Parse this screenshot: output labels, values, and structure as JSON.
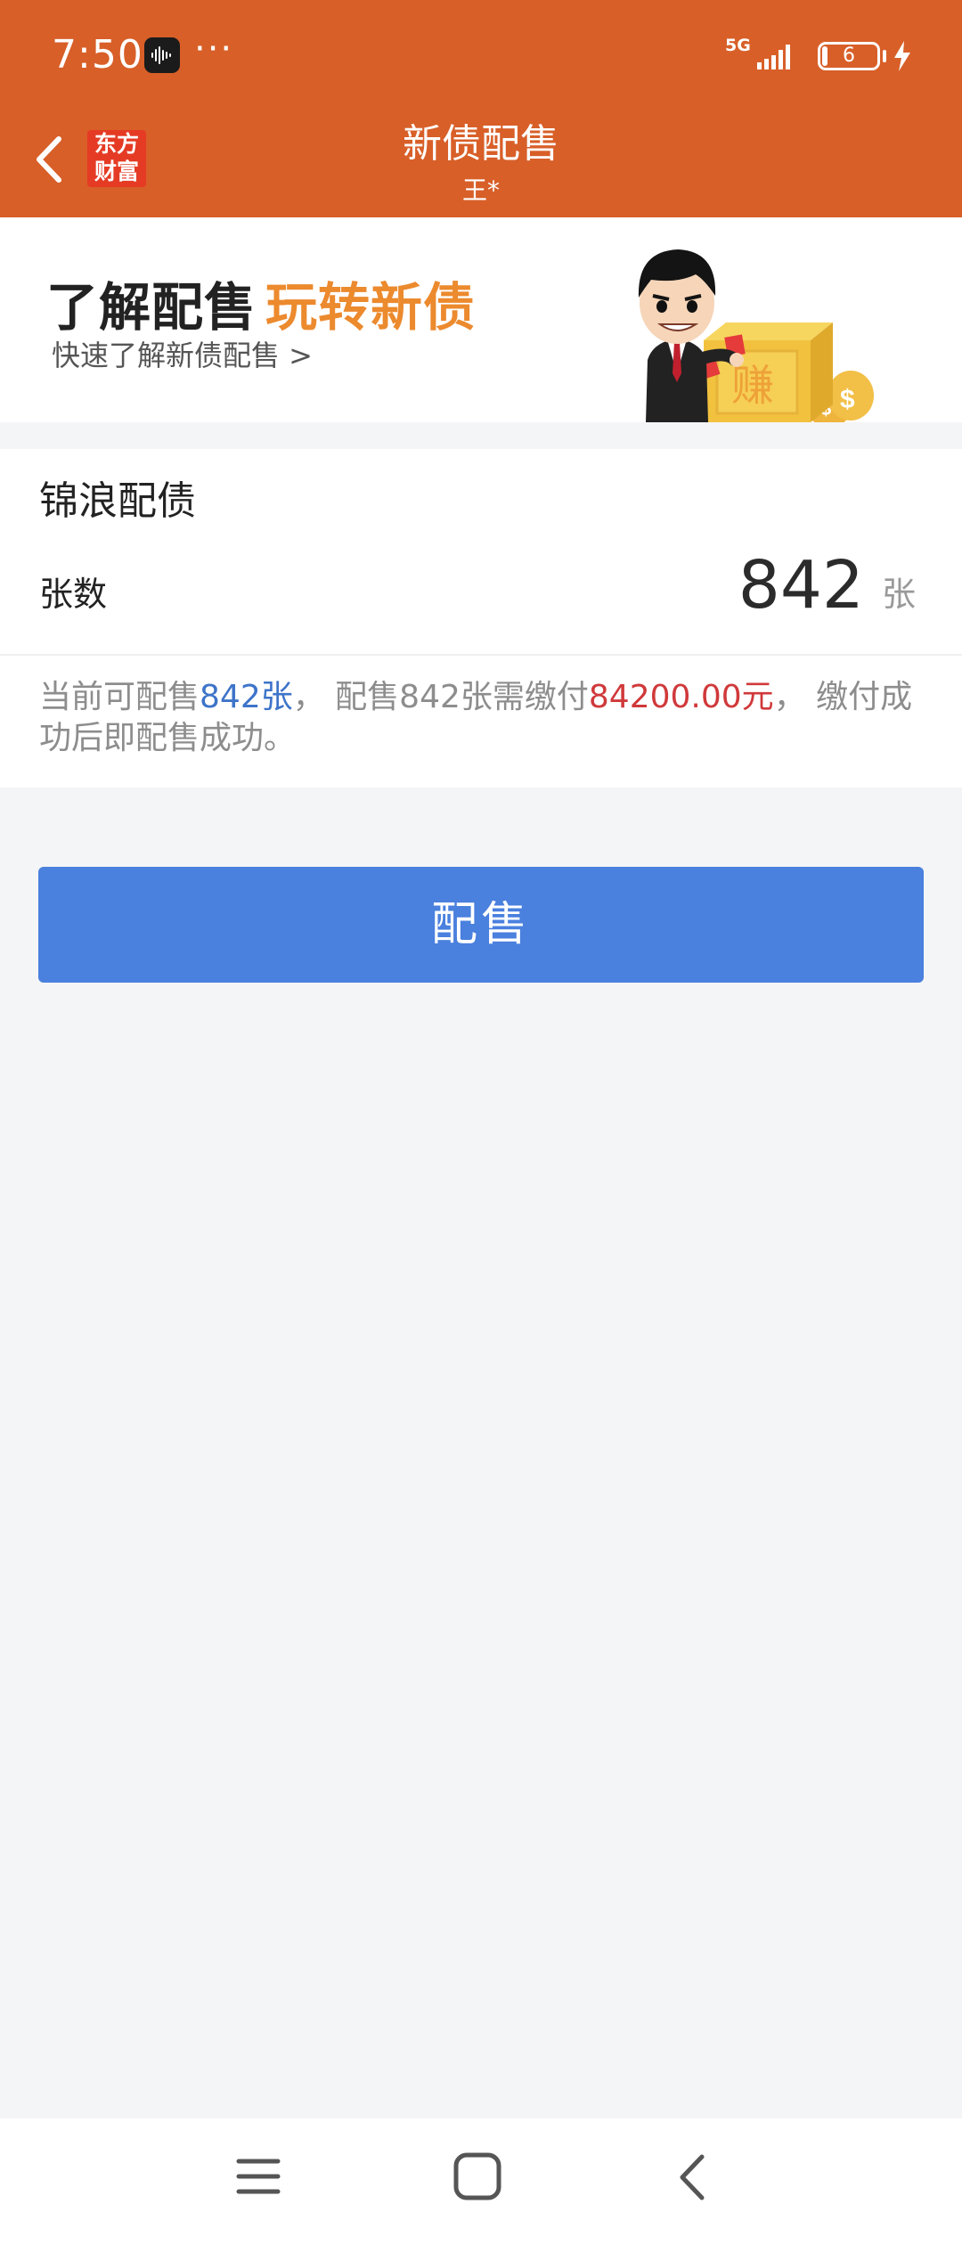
{
  "status_bar": {
    "time": "7:50",
    "dots": "···",
    "network": "5G",
    "battery": "6"
  },
  "header": {
    "logo_line1": "东方",
    "logo_line2": "财富",
    "title": "新债配售",
    "subtitle": "王*"
  },
  "banner": {
    "headline_a": "了解配售",
    "headline_b": "玩转新债",
    "sub": "快速了解新债配售 >",
    "badge_char": "赚"
  },
  "card": {
    "title": "锦浪配债",
    "qty_label": "张数",
    "qty_value": "842",
    "qty_unit": "张",
    "note": {
      "p1": "当前可配售",
      "available": "842张",
      "p2": "， 配售842张需缴付",
      "amount": "84200.00元",
      "p3": "， 缴付成功后即配售成功。"
    }
  },
  "action": {
    "label": "配售"
  },
  "colors": {
    "header_bg": "#d85f28",
    "button_bg": "#4a80de",
    "highlight_blue": "#3e74c9",
    "highlight_red": "#d0393a",
    "banner_accent": "#ec8a2e"
  },
  "icons": {
    "back": "chevron-left-icon",
    "recorder": "sound-recorder-icon",
    "menu": "menu-icon",
    "home": "home-square-icon",
    "nav_back": "back-chevron-icon"
  }
}
